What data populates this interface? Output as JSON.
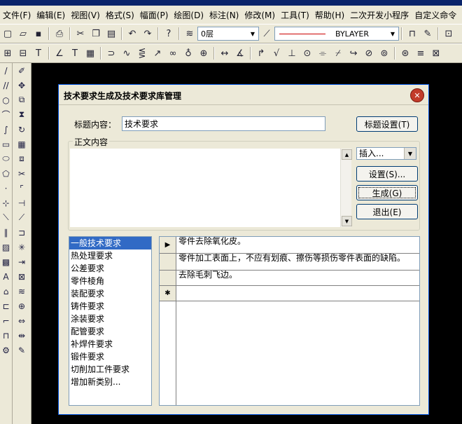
{
  "menubar": {
    "items": [
      "文件(F)",
      "编辑(E)",
      "视图(V)",
      "格式(S)",
      "幅面(P)",
      "绘图(D)",
      "标注(N)",
      "修改(M)",
      "工具(T)",
      "帮助(H)",
      "二次开发小程序",
      "自定义命令"
    ]
  },
  "toolbar": {
    "layer_value": "0层",
    "linetype_value": "BYLAYER"
  },
  "dialog": {
    "title": "技术要求生成及技术要求库管理",
    "title_label": "标题内容：",
    "title_value": "技术要求",
    "title_settings_button": "标题设置(T)",
    "body_group_label": "正文内容",
    "body_text": "",
    "insert_dropdown": "插入...",
    "settings_button": "设置(S)...",
    "generate_button": "生成(G)",
    "exit_button": "退出(E)",
    "categories": [
      "一般技术要求",
      "热处理要求",
      "公差要求",
      "零件棱角",
      "装配要求",
      "铸件要求",
      "涂装要求",
      "配管要求",
      "补焊件要求",
      "锻件要求",
      "切削加工件要求",
      "增加新类别..."
    ],
    "selected_category": "一般技术要求",
    "grid_rows": [
      "零件去除氧化皮。",
      "零件加工表面上，不应有划痕、擦伤等损伤零件表面的缺陷。",
      "去除毛刺飞边。",
      ""
    ],
    "current_row_marker": "▶",
    "new_row_marker": "✱"
  }
}
